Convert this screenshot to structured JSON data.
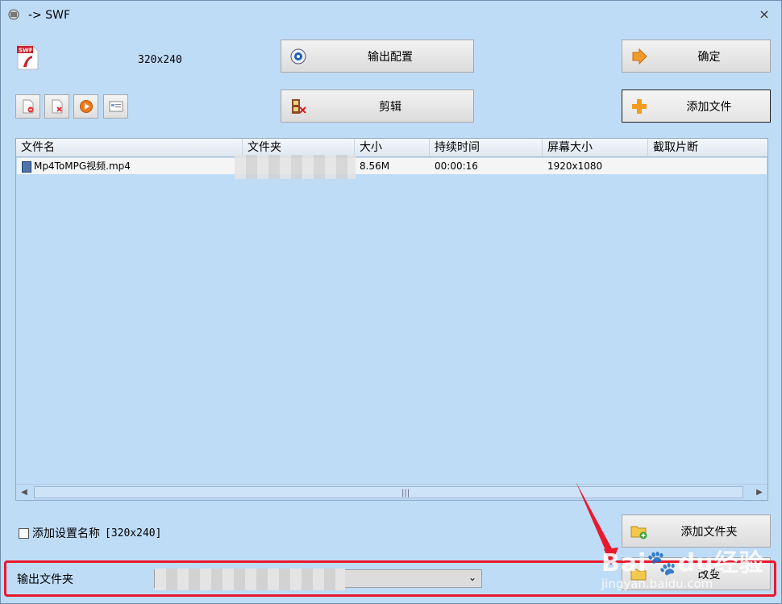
{
  "window": {
    "title": "-> SWF",
    "close_glyph": "×"
  },
  "format": {
    "icon": "swf-file-icon",
    "resolution": "320x240"
  },
  "buttons": {
    "config": "输出配置",
    "edit": "剪辑",
    "ok": "确定",
    "add_file": "添加文件",
    "add_folder": "添加文件夹",
    "change": "改变"
  },
  "toolbar_icons": [
    "remove-file-icon",
    "delete-file-icon",
    "play-icon",
    "info-icon"
  ],
  "table": {
    "columns": [
      "文件名",
      "文件夹",
      "大小",
      "持续时间",
      "屏幕大小",
      "截取片断"
    ],
    "rows": [
      {
        "name": "Mp4ToMPG视频.mp4",
        "folder": "",
        "size": "8.56M",
        "duration": "00:00:16",
        "screen": "1920x1080",
        "clip": ""
      }
    ]
  },
  "checkbox": {
    "label": "添加设置名称",
    "value": "[320x240]",
    "checked": false
  },
  "output": {
    "label": "输出文件夹",
    "path": ""
  },
  "watermark": {
    "brand": "Bai",
    "brand2": "du",
    "cn": "经验",
    "site": "jingyan.baidu.com"
  },
  "colors": {
    "highlight": "#e8192c",
    "background": "#bfdcf7"
  }
}
